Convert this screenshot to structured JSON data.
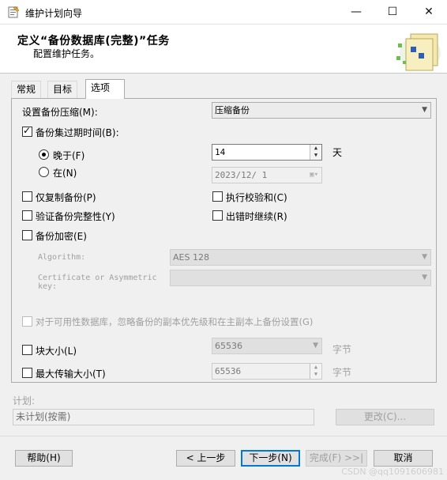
{
  "window": {
    "title": "维护计划向导",
    "minimize": "—",
    "maximize": "☐",
    "close": "✕"
  },
  "header": {
    "title": "定义“备份数据库(完整)”任务",
    "subtitle": "配置维护任务。"
  },
  "tabs": [
    {
      "label": "常规"
    },
    {
      "label": "目标"
    },
    {
      "label": "选项"
    }
  ],
  "options": {
    "compression_label": "设置备份压缩(M):",
    "compression_value": "压缩备份",
    "expire_label": "备份集过期时间(B):",
    "after_label": "晚于(F)",
    "after_value": "14",
    "after_unit": "天",
    "on_label": "在(N)",
    "on_value": "2023/12/ 1",
    "copy_only_label": "仅复制备份(P)",
    "checksum_label": "执行校验和(C)",
    "verify_label": "验证备份完整性(Y)",
    "continue_on_error_label": "出错时继续(R)",
    "encryption_label": "备份加密(E)",
    "algorithm_label": "Algorithm:",
    "algorithm_value": "AES 128",
    "certificate_label_1": "Certificate or Asymmetric",
    "certificate_label_2": "key:",
    "ag_label": "对于可用性数据库，忽略备份的副本优先级和在主副本上备份设置(G)",
    "block_size_label": "块大小(L)",
    "block_size_value": "65536",
    "block_size_unit": "字节",
    "max_transfer_label": "最大传输大小(T)",
    "max_transfer_value": "65536",
    "max_transfer_unit": "字节"
  },
  "schedule": {
    "label": "计划:",
    "value": "未计划(按需)",
    "change_button": "更改(C)..."
  },
  "footer": {
    "help": "帮助(H)",
    "back": "< 上一步",
    "next": "下一步(N)",
    "finish": "完成(F) >>|",
    "cancel": "取消"
  },
  "watermark": "CSDN @qq1091606981",
  "checked": {
    "expire": true,
    "after": true,
    "copy_only": false,
    "checksum": false,
    "verify": false,
    "continue_on_error": false,
    "encryption": false,
    "ag": false,
    "block_size": false,
    "max_transfer": false
  },
  "colors": {
    "accent": "#0078d7",
    "disabled_text": "#a0a0a0"
  }
}
